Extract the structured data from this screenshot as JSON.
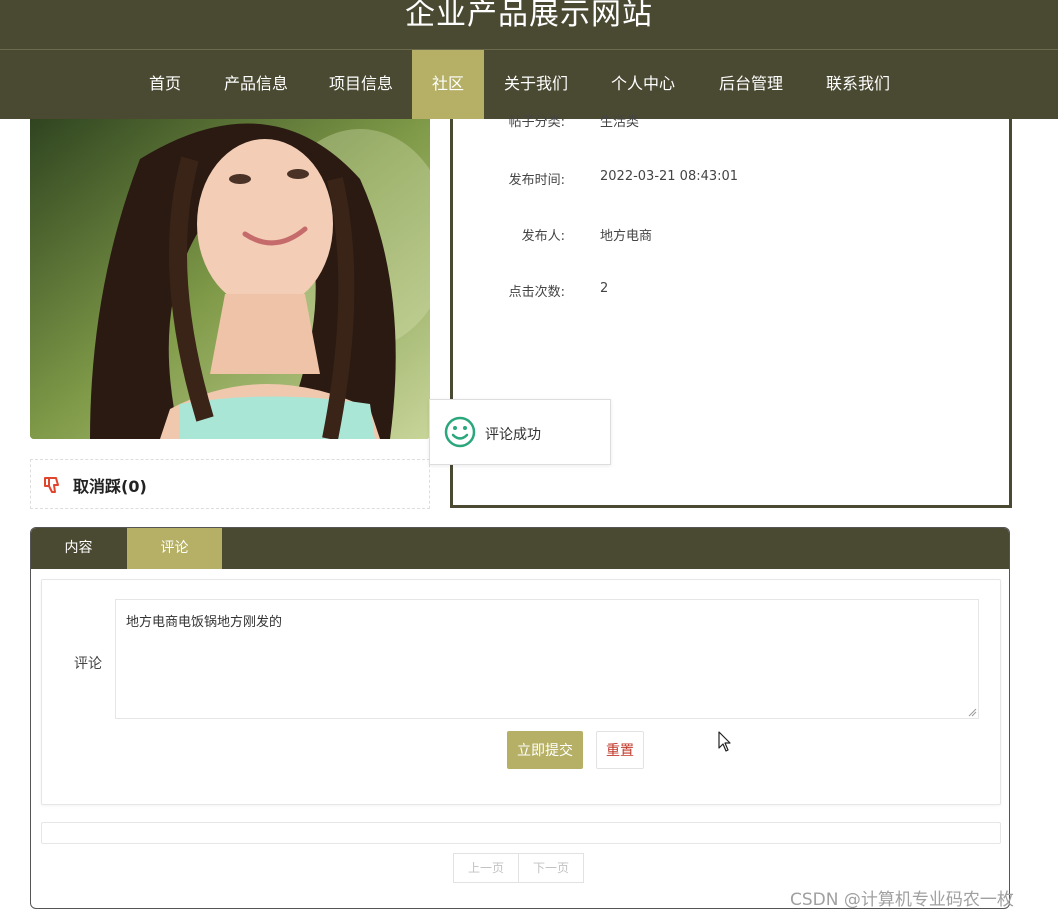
{
  "header": {
    "site_title": "企业产品展示网站"
  },
  "nav": [
    {
      "label": "首页"
    },
    {
      "label": "产品信息"
    },
    {
      "label": "项目信息"
    },
    {
      "label": "社区"
    },
    {
      "label": "关于我们"
    },
    {
      "label": "个人中心"
    },
    {
      "label": "后台管理"
    },
    {
      "label": "联系我们"
    }
  ],
  "nav_active": "社区",
  "post": {
    "partial_row": {
      "label": "帖子分类:",
      "value": "生活类"
    },
    "rows": [
      {
        "label": "发布时间:",
        "value": "2022-03-21 08:43:01"
      },
      {
        "label": "发布人:",
        "value": "地方电商"
      },
      {
        "label": "点击次数:",
        "value": "2"
      }
    ]
  },
  "vote": {
    "label": "取消踩(0)",
    "icon": "thumb-down-icon"
  },
  "toast": {
    "text": "评论成功",
    "icon": "smiley-icon"
  },
  "tabs": [
    {
      "label": "内容"
    },
    {
      "label": "评论"
    }
  ],
  "tab_active": "评论",
  "comment_form": {
    "label": "评论",
    "value": "地方电商电饭锅地方刚发的",
    "submit_label": "立即提交",
    "reset_label": "重置"
  },
  "pager": {
    "prev": "上一页",
    "next": "下一页"
  },
  "watermark": "CSDN @计算机专业码农一枚",
  "colors": {
    "nav_bg": "#4a4932",
    "accent": "#b5b065",
    "reset_text": "#c0392b",
    "toast_icon": "#2ba77c"
  }
}
